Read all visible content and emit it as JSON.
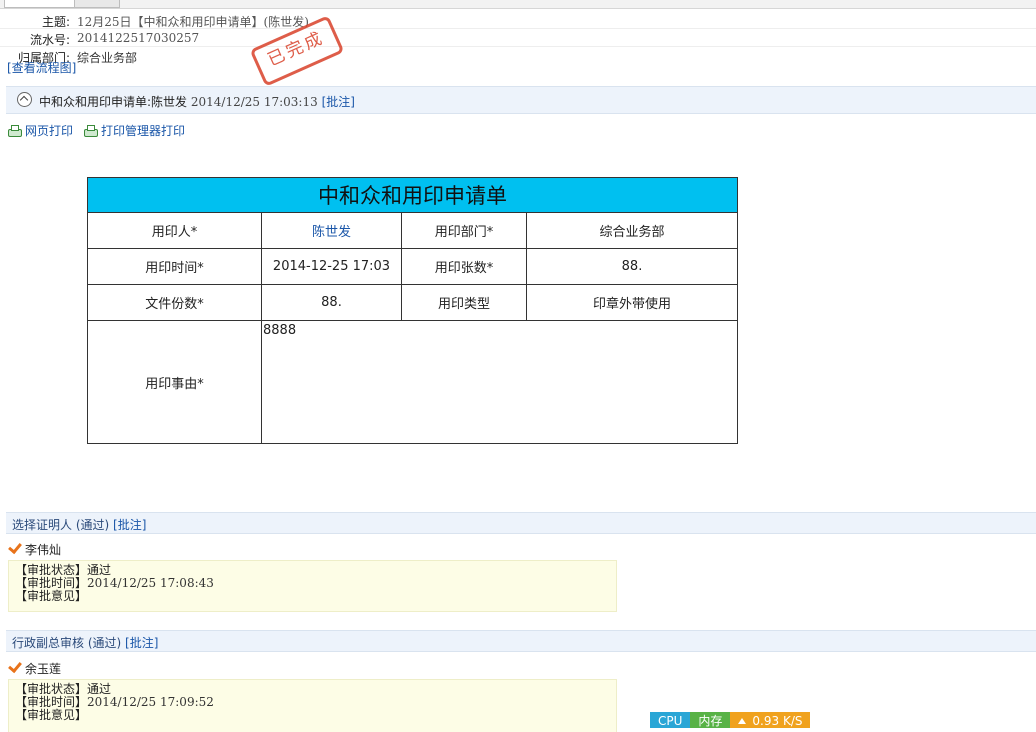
{
  "header": {
    "subject_label": "主题:",
    "subject_value": "12月25日【中和众和用印申请单】(陈世发)",
    "serial_label": "流水号:",
    "serial_value": "2014122517030257",
    "dept_label": "归属部门:",
    "dept_value": "综合业务部",
    "flow_link": "[查看流程图]",
    "stamp": "已完成"
  },
  "record_bar": {
    "text": "中和众和用印申请单:陈世发",
    "date": "2014/12/25 17:03:13",
    "comment_link": "[批注]"
  },
  "print": {
    "web_print": "网页打印",
    "manager_print": "打印管理器打印"
  },
  "form": {
    "title": "中和众和用印申请单",
    "row1": {
      "label1": "用印人*",
      "value1": "陈世发",
      "label2": "用印部门*",
      "value2": "综合业务部"
    },
    "row2": {
      "label1": "用印时间*",
      "value1": "2014-12-25 17:03",
      "label2": "用印张数*",
      "value2": "88."
    },
    "row3": {
      "label1": "文件份数*",
      "value1": "88.",
      "label2": "用印类型",
      "value2": "印章外带使用"
    },
    "row4": {
      "label1": "用印事由*",
      "value1": "8888"
    }
  },
  "steps": [
    {
      "title": "选择证明人 (通过)",
      "comment_link": "[批注]",
      "approver": "李伟灿",
      "status_label": "【审批状态】",
      "status_value": "通过",
      "time_label": "【审批时间】",
      "time_value": "2014/12/25 17:08:43",
      "opinion_label": "【审批意见】"
    },
    {
      "title": "行政副总审核 (通过)",
      "comment_link": "[批注]",
      "approver": "余玉莲",
      "status_label": "【审批状态】",
      "status_value": "通过",
      "time_label": "【审批时间】",
      "time_value": "2014/12/25 17:09:52",
      "opinion_label": "【审批意见】"
    }
  ],
  "status_bar": {
    "cpu": "CPU",
    "memory": "内存",
    "net": "0.93 K/S"
  },
  "colors": {
    "form_title_bg": "#00c0f0",
    "link": "#1a56a8",
    "stamp": "#d9412a",
    "approve_bg": "#fdfde6"
  }
}
